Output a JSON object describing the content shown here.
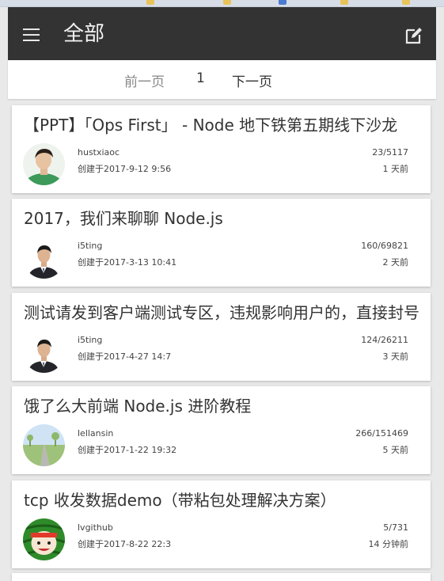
{
  "header": {
    "title": "全部"
  },
  "pager": {
    "prev_label": "前一页",
    "current_page": "1",
    "next_label": "下一页"
  },
  "topics": [
    {
      "title": "【PPT】「Ops First」 - Node 地下铁第五期线下沙龙",
      "author": "hustxiaoc",
      "created": "创建于2017-9-12 9:56",
      "counts": "23/5117",
      "ago": "1 天前",
      "avatar": "person-green-avatar"
    },
    {
      "title": "2017，我们来聊聊 Node.js",
      "author": "i5ting",
      "created": "创建于2017-3-13 10:41",
      "counts": "160/69821",
      "ago": "2 天前",
      "avatar": "person-suit-avatar"
    },
    {
      "title": "测试请发到客户端测试专区，违规影响用户的，直接封号",
      "author": "i5ting",
      "created": "创建于2017-4-27 14:7",
      "counts": "124/26211",
      "ago": "3 天前",
      "avatar": "person-suit-avatar"
    },
    {
      "title": "饿了么大前端 Node.js 进阶教程",
      "author": "lellansin",
      "created": "创建于2017-1-22 19:32",
      "counts": "266/151469",
      "ago": "5 天前",
      "avatar": "landscape-road-avatar"
    },
    {
      "title": "tcp 收发数据demo（带粘包处理解决方案）",
      "author": "lvgithub",
      "created": "创建于2017-8-22 22:3",
      "counts": "5/731",
      "ago": "14 分钟前",
      "avatar": "watermelon-cartoon-avatar"
    }
  ],
  "colors": {
    "header_bg": "#333333",
    "page_bg": "#e9e9e9",
    "card_bg": "#ffffff",
    "disabled_text": "#888888"
  },
  "icons": {
    "menu": "hamburger-menu-icon",
    "edit": "edit-pencil-icon"
  }
}
